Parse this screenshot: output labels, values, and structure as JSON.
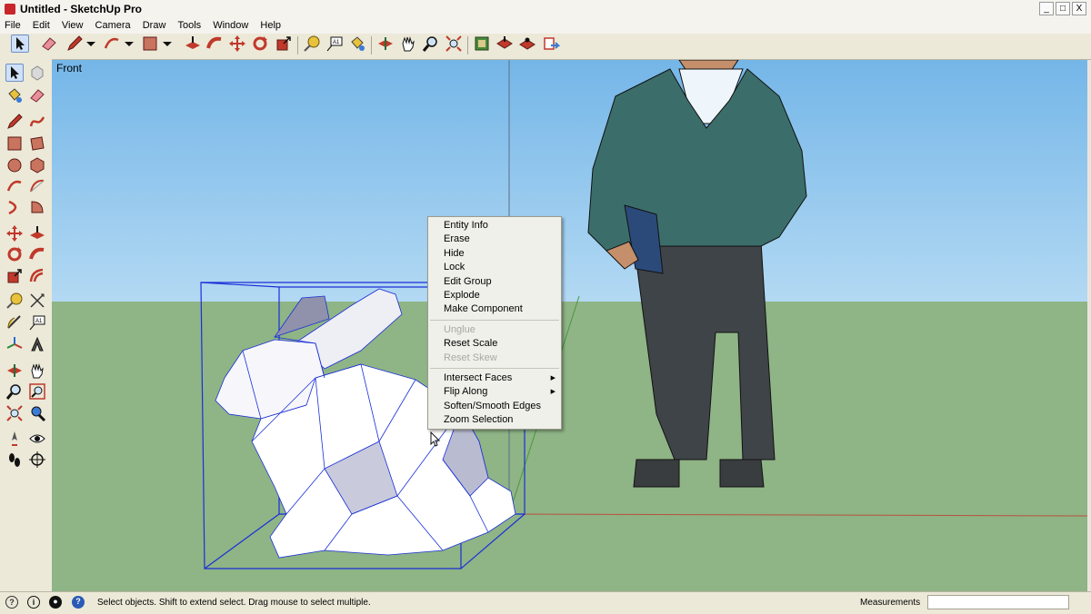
{
  "window": {
    "title": "Untitled - SketchUp Pro",
    "controls": [
      "_",
      "□",
      "X"
    ]
  },
  "menubar": {
    "items": [
      "File",
      "Edit",
      "View",
      "Camera",
      "Draw",
      "Tools",
      "Window",
      "Help"
    ]
  },
  "viewport": {
    "scene_label": "Front"
  },
  "context_menu": {
    "groups": [
      [
        {
          "label": "Entity Info",
          "enabled": true
        },
        {
          "label": "Erase",
          "enabled": true
        },
        {
          "label": "Hide",
          "enabled": true
        },
        {
          "label": "Lock",
          "enabled": true
        },
        {
          "label": "Edit Group",
          "enabled": true
        },
        {
          "label": "Explode",
          "enabled": true
        },
        {
          "label": "Make Component",
          "enabled": true
        }
      ],
      [
        {
          "label": "Unglue",
          "enabled": false
        },
        {
          "label": "Reset Scale",
          "enabled": true
        },
        {
          "label": "Reset Skew",
          "enabled": false
        }
      ],
      [
        {
          "label": "Intersect Faces",
          "enabled": true,
          "submenu": true
        },
        {
          "label": "Flip Along",
          "enabled": true,
          "submenu": true
        },
        {
          "label": "Soften/Smooth Edges",
          "enabled": true
        },
        {
          "label": "Zoom Selection",
          "enabled": true
        }
      ]
    ]
  },
  "statusbar": {
    "hint": "Select objects. Shift to extend select. Drag mouse to select multiple.",
    "measurements_label": "Measurements",
    "measurements_value": ""
  },
  "toolbar_top": {
    "icons": [
      "select-icon",
      "eraser-icon",
      "pencil-icon",
      "dropdown-icon",
      "arc-icon",
      "dropdown-icon",
      "rectangle-icon",
      "dropdown-icon",
      "push-pull-icon",
      "follow-me-icon",
      "move-icon",
      "rotate-icon",
      "scale-icon",
      "tape-measure-icon",
      "text-icon",
      "paint-bucket-icon",
      "orbit-icon",
      "pan-icon",
      "zoom-icon",
      "zoom-extents-icon",
      "warehouse-icon",
      "share-model-icon",
      "extension-warehouse-icon",
      "send-to-layout-icon"
    ]
  },
  "toolbar_left": {
    "icons": [
      "select-icon",
      "component-icon",
      "paint-bucket-icon",
      "eraser-icon",
      "line-icon",
      "freehand-icon",
      "rectangle-icon",
      "rotated-rectangle-icon",
      "circle-icon",
      "polygon-icon",
      "arc-icon",
      "two-point-arc-icon",
      "three-point-arc-icon",
      "pie-icon",
      "move-icon",
      "push-pull-icon",
      "rotate-icon",
      "follow-me-icon",
      "scale-icon",
      "offset-icon",
      "tape-measure-icon",
      "dimension-icon",
      "protractor-icon",
      "text-icon",
      "axes-icon",
      "3d-text-icon",
      "orbit-icon",
      "pan-icon",
      "zoom-icon",
      "zoom-window-icon",
      "zoom-extents-icon",
      "previous-view-icon",
      "position-camera-icon",
      "look-around-icon",
      "walk-icon",
      "section-plane-icon"
    ]
  },
  "colors": {
    "sky_top": "#74b6e8",
    "ground": "#8fb486",
    "selection": "#1a2fd8",
    "accent_red": "#c8262b"
  }
}
